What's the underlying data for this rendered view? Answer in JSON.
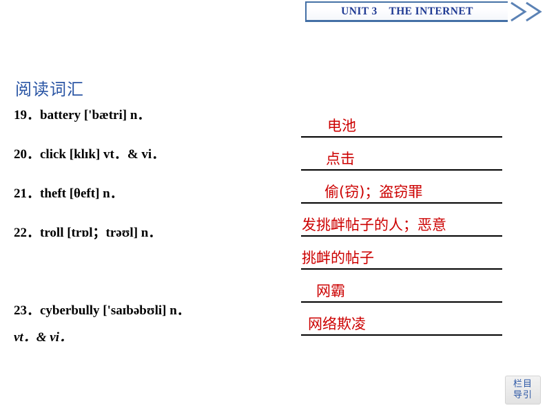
{
  "header": {
    "unit_title": "UNIT 3    THE INTERNET",
    "chevron_icon_1": "chevron-right-icon",
    "chevron_icon_2": "chevron-right-icon"
  },
  "section": {
    "title": "阅读词汇"
  },
  "vocabulary": [
    {
      "number": "19",
      "text": "19．battery ['bætri] n．"
    },
    {
      "number": "20",
      "text": "20．click [klɪk] vt．& vi．"
    },
    {
      "number": "21",
      "text": "21．theft [θeft] n．"
    },
    {
      "number": "22",
      "text": "22．troll [trɒl；trəʊl] n．"
    },
    {
      "number": "23",
      "text": "23．cyberbully ['saɪbəbʊli] n．"
    }
  ],
  "vocabulary_continuation": "vt．& vi．",
  "answers": [
    {
      "text": "电池",
      "indent": 38
    },
    {
      "text": "点击",
      "indent": 36
    },
    {
      "text": "偷(窃)；盗窃罪",
      "indent": 34
    },
    {
      "text": "发挑衅帖子的人；恶意",
      "indent": 1
    },
    {
      "text": "挑衅的帖子",
      "indent": 1
    },
    {
      "text": "网霸",
      "indent": 22
    },
    {
      "text": "网络欺凌",
      "indent": 10
    }
  ],
  "nav_button": {
    "line1": "栏目",
    "line2": "导引"
  },
  "colors": {
    "accent_blue": "#2a55a4",
    "header_blue": "#1f3a93",
    "border_blue": "#436fa5",
    "answer_red": "#cc0000",
    "rule_black": "#000000",
    "page_background": "#ffffff"
  }
}
